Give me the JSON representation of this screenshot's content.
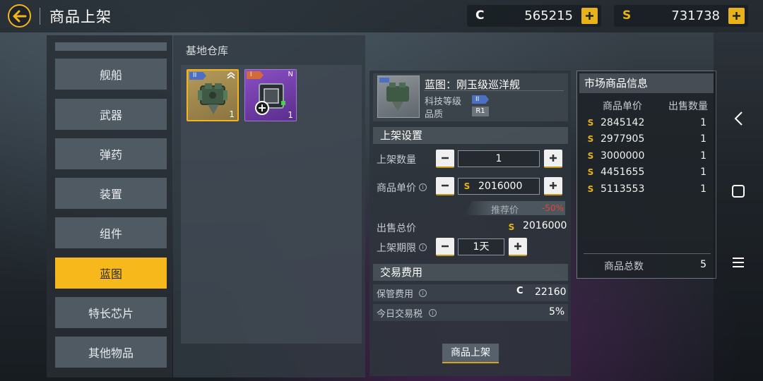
{
  "header": {
    "title": "商品上架",
    "currency_c": {
      "symbol": "C",
      "value": "565215"
    },
    "currency_s": {
      "symbol": "S",
      "value": "731738"
    }
  },
  "categories": [
    {
      "label": "舰船"
    },
    {
      "label": "武器"
    },
    {
      "label": "弹药"
    },
    {
      "label": "装置"
    },
    {
      "label": "组件"
    },
    {
      "label": "蓝图",
      "active": true
    },
    {
      "label": "特长芯片"
    },
    {
      "label": "其他物品"
    }
  ],
  "warehouse": {
    "title": "基地仓库",
    "items": [
      {
        "tier": "II",
        "qty": "1",
        "selected": true
      },
      {
        "tier": "I",
        "badge": "N",
        "qty": "1"
      }
    ]
  },
  "item": {
    "name": "蓝图：刚玉级巡洋舰",
    "tech_level_label": "科技等级",
    "tech_level": "II",
    "quality_label": "品质",
    "quality": "R1"
  },
  "listing": {
    "section_title": "上架设置",
    "quantity_label": "上架数量",
    "quantity": "1",
    "unit_price_label": "商品单价",
    "unit_price": "2016000",
    "recommended_label": "推荐价",
    "recommended_pct": "-50%",
    "total_label": "出售总价",
    "total": "2016000",
    "duration_label": "上架期限",
    "duration": "1天"
  },
  "fees": {
    "section_title": "交易费用",
    "storage_label": "保管费用",
    "storage_value": "22160",
    "tax_label": "今日交易税",
    "tax_value": "5%"
  },
  "submit_label": "商品上架",
  "market": {
    "title": "市场商品信息",
    "col_price": "商品单价",
    "col_qty": "出售数量",
    "rows": [
      {
        "price": "2845142",
        "qty": "1"
      },
      {
        "price": "2977905",
        "qty": "1"
      },
      {
        "price": "3000000",
        "qty": "1"
      },
      {
        "price": "4451655",
        "qty": "1"
      },
      {
        "price": "5113553",
        "qty": "1"
      }
    ],
    "total_label": "商品总数",
    "total_value": "5"
  },
  "colors": {
    "accent": "#f7b81b",
    "discount": "#e0463a"
  }
}
